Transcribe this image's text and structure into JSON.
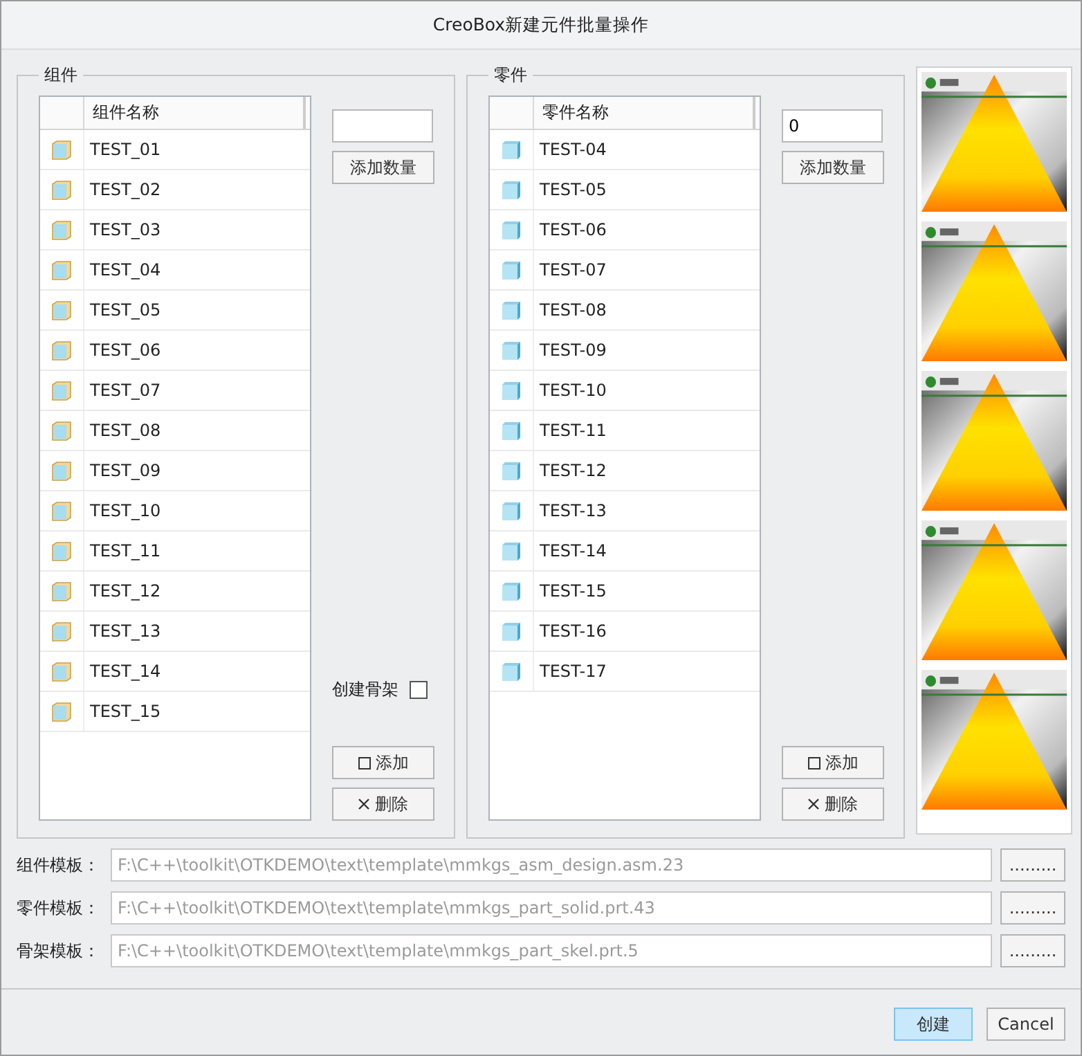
{
  "window": {
    "title": "CreoBox新建元件批量操作"
  },
  "groups": [
    {
      "kind": "assembly",
      "title": "组件",
      "column": "组件名称",
      "rows": [
        "TEST_01",
        "TEST_02",
        "TEST_03",
        "TEST_04",
        "TEST_05",
        "TEST_06",
        "TEST_07",
        "TEST_08",
        "TEST_09",
        "TEST_10",
        "TEST_11",
        "TEST_12",
        "TEST_13",
        "TEST_14",
        "TEST_15"
      ],
      "add_count_button": "添加数量",
      "skeleton_checkbox": {
        "label": "创建骨架",
        "checked": false
      },
      "add_button": "添加",
      "delete_button": "删除"
    },
    {
      "kind": "part",
      "title": "零件",
      "column": "零件名称",
      "rows": [
        "TEST-04",
        "TEST-05",
        "TEST-06",
        "TEST-07",
        "TEST-08",
        "TEST-09",
        "TEST-10",
        "TEST-11",
        "TEST-12",
        "TEST-13",
        "TEST-14",
        "TEST-15",
        "TEST-16",
        "TEST-17"
      ],
      "count_field": {
        "value": "0"
      },
      "add_count_button": "添加数量",
      "add_button": "添加",
      "delete_button": "删除"
    }
  ],
  "templates": [
    {
      "label": "组件模板：",
      "path": "F:\\C++\\toolkit\\OTKDEMO\\text\\template\\mmkgs_asm_design.asm.23",
      "disabled": true,
      "browse": "........."
    },
    {
      "label": "零件模板：",
      "path": "F:\\C++\\toolkit\\OTKDEMO\\text\\template\\mmkgs_part_solid.prt.43",
      "disabled": true,
      "browse": "........."
    },
    {
      "label": "骨架模板：",
      "path": "F:\\C++\\toolkit\\OTKDEMO\\text\\template\\mmkgs_part_skel.prt.5",
      "disabled": true,
      "browse": "........."
    }
  ],
  "buttons": [
    {
      "label": "创建",
      "default": true
    },
    {
      "label": "Cancel",
      "default": false
    }
  ]
}
